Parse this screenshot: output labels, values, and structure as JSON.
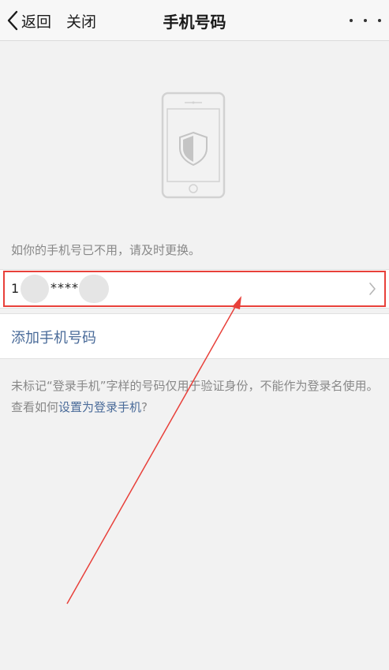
{
  "navbar": {
    "back_label": "返回",
    "close_label": "关闭",
    "title": "手机号码"
  },
  "hint": "如你的手机号已不用，请及时更换。",
  "phone_row": {
    "prefix": "1",
    "masked": "****"
  },
  "add_phone_label": "添加手机号码",
  "footnote": {
    "text": "未标记“登录手机”字样的号码仅用于验证身份，不能作为登录名使用。查看如何",
    "link": "设置为登录手机",
    "suffix": "?"
  },
  "colors": {
    "link": "#4a6b99",
    "annotation": "#e8403a",
    "background": "#f2f2f2"
  },
  "icons": [
    "chevron-left-icon",
    "more-icon",
    "phone-shield-icon",
    "chevron-right-icon"
  ]
}
